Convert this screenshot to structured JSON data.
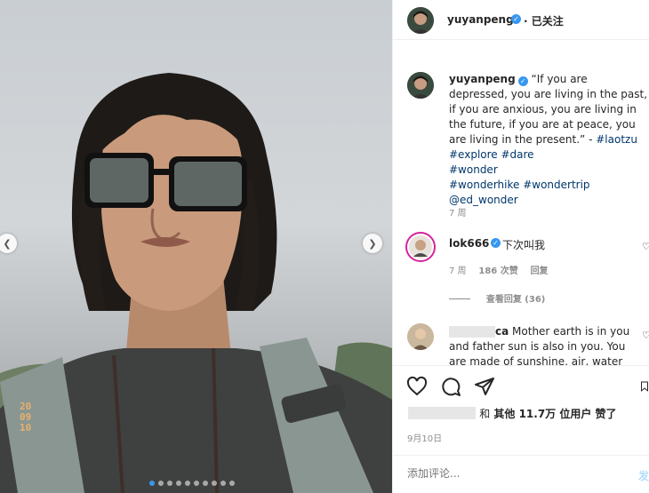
{
  "post": {
    "username": "yuyanpeng",
    "follow_label": "· 已关注",
    "caption_text": "“If you are depressed, you are living in the past, if you are anxious, you are living in the future, if you are at peace, you are living in the present.” -",
    "hashtags_line1": "#laotzu #explore #dare",
    "hashtags_line2": "#wonder",
    "hashtags_line3": "#wonderhike #wondertrip",
    "mention": "@ed_wonder",
    "caption_time": "7 周",
    "photo_date_stamp": "20 09 10",
    "carousel_total": 10,
    "carousel_active": 1
  },
  "comments": [
    {
      "username": "lok666",
      "text": "下次叫我",
      "time": "7 周",
      "likes": "186 次赞",
      "reply": "回复",
      "view_replies": "查看回复 (36)"
    },
    {
      "username_partial": "ca",
      "text": "Mother earth is in you and father sun is also in you. You are made of sunshine, air, water"
    }
  ],
  "actions": {
    "likes_prefix": "和",
    "likes_text": "其他 11.7万 位用户 赞了",
    "date": "9月10日"
  },
  "composer": {
    "placeholder": "添加评论...",
    "post_label": "发"
  }
}
